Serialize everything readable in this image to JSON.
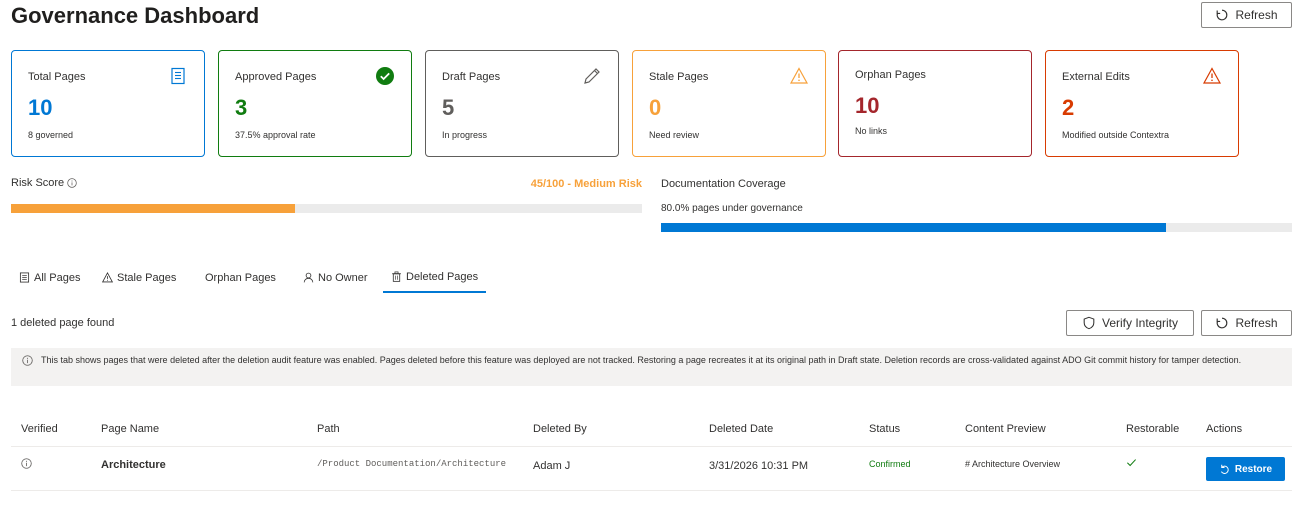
{
  "header": {
    "title": "Governance Dashboard",
    "refresh_label": "Refresh"
  },
  "cards": [
    {
      "label": "Total Pages",
      "value": "10",
      "sub": "8 governed",
      "color": "#0078d4",
      "icon": "document-list-icon"
    },
    {
      "label": "Approved Pages",
      "value": "3",
      "sub": "37.5% approval rate",
      "color": "#107c10",
      "icon": "check-circle-icon"
    },
    {
      "label": "Draft Pages",
      "value": "5",
      "sub": "In progress",
      "color": "#605e5c",
      "icon": "pencil-icon"
    },
    {
      "label": "Stale Pages",
      "value": "0",
      "sub": "Need review",
      "color": "#f7a13a",
      "icon": "warning-icon"
    },
    {
      "label": "Orphan Pages",
      "value": "10",
      "sub": "No links",
      "color": "#a4262c",
      "icon": ""
    },
    {
      "label": "External Edits",
      "value": "2",
      "sub": "Modified outside Contextra",
      "color": "#d83b01",
      "icon": "warning-icon"
    }
  ],
  "risk": {
    "label": "Risk Score",
    "value_text": "45/100 - Medium Risk",
    "score": 45,
    "max": 100,
    "color": "#f7a13a"
  },
  "coverage": {
    "label": "Documentation Coverage",
    "sub": "80.0% pages under governance",
    "percent": 80.0,
    "color": "#0078d4"
  },
  "tabs": [
    {
      "label": "All Pages",
      "icon": "list-icon"
    },
    {
      "label": "Stale Pages",
      "icon": "warning-icon"
    },
    {
      "label": "Orphan Pages",
      "icon": ""
    },
    {
      "label": "No Owner",
      "icon": "person-icon"
    },
    {
      "label": "Deleted Pages",
      "icon": "trash-icon",
      "active": true
    }
  ],
  "deleted": {
    "count_text": "1 deleted page found",
    "verify_label": "Verify Integrity",
    "refresh_label": "Refresh",
    "notice": "This tab shows pages that were deleted after the deletion audit feature was enabled. Pages deleted before this feature was deployed are not tracked. Restoring a page recreates it at its original path in Draft state. Deletion records are cross-validated against ADO Git commit history for tamper detection."
  },
  "table": {
    "columns": [
      "Verified",
      "Page Name",
      "Path",
      "Deleted By",
      "Deleted Date",
      "Status",
      "Content Preview",
      "Restorable",
      "Actions"
    ],
    "rows": [
      {
        "verified_icon": "info-icon",
        "page_name": "Architecture",
        "path": "/Product Documentation/Architecture",
        "deleted_by": "Adam J",
        "deleted_date": "3/31/2026 10:31 PM",
        "status": "Confirmed",
        "preview": "# Architecture Overview",
        "restorable_icon": "checkmark-icon",
        "action_label": "Restore"
      }
    ]
  }
}
